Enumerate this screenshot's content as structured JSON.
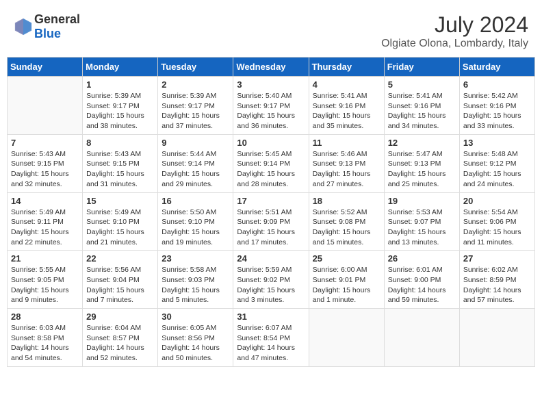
{
  "header": {
    "logo_general": "General",
    "logo_blue": "Blue",
    "month_year": "July 2024",
    "location": "Olgiate Olona, Lombardy, Italy"
  },
  "days_of_week": [
    "Sunday",
    "Monday",
    "Tuesday",
    "Wednesday",
    "Thursday",
    "Friday",
    "Saturday"
  ],
  "weeks": [
    [
      {
        "day": "",
        "sunrise": "",
        "sunset": "",
        "daylight": ""
      },
      {
        "day": "1",
        "sunrise": "Sunrise: 5:39 AM",
        "sunset": "Sunset: 9:17 PM",
        "daylight": "Daylight: 15 hours and 38 minutes."
      },
      {
        "day": "2",
        "sunrise": "Sunrise: 5:39 AM",
        "sunset": "Sunset: 9:17 PM",
        "daylight": "Daylight: 15 hours and 37 minutes."
      },
      {
        "day": "3",
        "sunrise": "Sunrise: 5:40 AM",
        "sunset": "Sunset: 9:17 PM",
        "daylight": "Daylight: 15 hours and 36 minutes."
      },
      {
        "day": "4",
        "sunrise": "Sunrise: 5:41 AM",
        "sunset": "Sunset: 9:16 PM",
        "daylight": "Daylight: 15 hours and 35 minutes."
      },
      {
        "day": "5",
        "sunrise": "Sunrise: 5:41 AM",
        "sunset": "Sunset: 9:16 PM",
        "daylight": "Daylight: 15 hours and 34 minutes."
      },
      {
        "day": "6",
        "sunrise": "Sunrise: 5:42 AM",
        "sunset": "Sunset: 9:16 PM",
        "daylight": "Daylight: 15 hours and 33 minutes."
      }
    ],
    [
      {
        "day": "7",
        "sunrise": "Sunrise: 5:43 AM",
        "sunset": "Sunset: 9:15 PM",
        "daylight": "Daylight: 15 hours and 32 minutes."
      },
      {
        "day": "8",
        "sunrise": "Sunrise: 5:43 AM",
        "sunset": "Sunset: 9:15 PM",
        "daylight": "Daylight: 15 hours and 31 minutes."
      },
      {
        "day": "9",
        "sunrise": "Sunrise: 5:44 AM",
        "sunset": "Sunset: 9:14 PM",
        "daylight": "Daylight: 15 hours and 29 minutes."
      },
      {
        "day": "10",
        "sunrise": "Sunrise: 5:45 AM",
        "sunset": "Sunset: 9:14 PM",
        "daylight": "Daylight: 15 hours and 28 minutes."
      },
      {
        "day": "11",
        "sunrise": "Sunrise: 5:46 AM",
        "sunset": "Sunset: 9:13 PM",
        "daylight": "Daylight: 15 hours and 27 minutes."
      },
      {
        "day": "12",
        "sunrise": "Sunrise: 5:47 AM",
        "sunset": "Sunset: 9:13 PM",
        "daylight": "Daylight: 15 hours and 25 minutes."
      },
      {
        "day": "13",
        "sunrise": "Sunrise: 5:48 AM",
        "sunset": "Sunset: 9:12 PM",
        "daylight": "Daylight: 15 hours and 24 minutes."
      }
    ],
    [
      {
        "day": "14",
        "sunrise": "Sunrise: 5:49 AM",
        "sunset": "Sunset: 9:11 PM",
        "daylight": "Daylight: 15 hours and 22 minutes."
      },
      {
        "day": "15",
        "sunrise": "Sunrise: 5:49 AM",
        "sunset": "Sunset: 9:10 PM",
        "daylight": "Daylight: 15 hours and 21 minutes."
      },
      {
        "day": "16",
        "sunrise": "Sunrise: 5:50 AM",
        "sunset": "Sunset: 9:10 PM",
        "daylight": "Daylight: 15 hours and 19 minutes."
      },
      {
        "day": "17",
        "sunrise": "Sunrise: 5:51 AM",
        "sunset": "Sunset: 9:09 PM",
        "daylight": "Daylight: 15 hours and 17 minutes."
      },
      {
        "day": "18",
        "sunrise": "Sunrise: 5:52 AM",
        "sunset": "Sunset: 9:08 PM",
        "daylight": "Daylight: 15 hours and 15 minutes."
      },
      {
        "day": "19",
        "sunrise": "Sunrise: 5:53 AM",
        "sunset": "Sunset: 9:07 PM",
        "daylight": "Daylight: 15 hours and 13 minutes."
      },
      {
        "day": "20",
        "sunrise": "Sunrise: 5:54 AM",
        "sunset": "Sunset: 9:06 PM",
        "daylight": "Daylight: 15 hours and 11 minutes."
      }
    ],
    [
      {
        "day": "21",
        "sunrise": "Sunrise: 5:55 AM",
        "sunset": "Sunset: 9:05 PM",
        "daylight": "Daylight: 15 hours and 9 minutes."
      },
      {
        "day": "22",
        "sunrise": "Sunrise: 5:56 AM",
        "sunset": "Sunset: 9:04 PM",
        "daylight": "Daylight: 15 hours and 7 minutes."
      },
      {
        "day": "23",
        "sunrise": "Sunrise: 5:58 AM",
        "sunset": "Sunset: 9:03 PM",
        "daylight": "Daylight: 15 hours and 5 minutes."
      },
      {
        "day": "24",
        "sunrise": "Sunrise: 5:59 AM",
        "sunset": "Sunset: 9:02 PM",
        "daylight": "Daylight: 15 hours and 3 minutes."
      },
      {
        "day": "25",
        "sunrise": "Sunrise: 6:00 AM",
        "sunset": "Sunset: 9:01 PM",
        "daylight": "Daylight: 15 hours and 1 minute."
      },
      {
        "day": "26",
        "sunrise": "Sunrise: 6:01 AM",
        "sunset": "Sunset: 9:00 PM",
        "daylight": "Daylight: 14 hours and 59 minutes."
      },
      {
        "day": "27",
        "sunrise": "Sunrise: 6:02 AM",
        "sunset": "Sunset: 8:59 PM",
        "daylight": "Daylight: 14 hours and 57 minutes."
      }
    ],
    [
      {
        "day": "28",
        "sunrise": "Sunrise: 6:03 AM",
        "sunset": "Sunset: 8:58 PM",
        "daylight": "Daylight: 14 hours and 54 minutes."
      },
      {
        "day": "29",
        "sunrise": "Sunrise: 6:04 AM",
        "sunset": "Sunset: 8:57 PM",
        "daylight": "Daylight: 14 hours and 52 minutes."
      },
      {
        "day": "30",
        "sunrise": "Sunrise: 6:05 AM",
        "sunset": "Sunset: 8:56 PM",
        "daylight": "Daylight: 14 hours and 50 minutes."
      },
      {
        "day": "31",
        "sunrise": "Sunrise: 6:07 AM",
        "sunset": "Sunset: 8:54 PM",
        "daylight": "Daylight: 14 hours and 47 minutes."
      },
      {
        "day": "",
        "sunrise": "",
        "sunset": "",
        "daylight": ""
      },
      {
        "day": "",
        "sunrise": "",
        "sunset": "",
        "daylight": ""
      },
      {
        "day": "",
        "sunrise": "",
        "sunset": "",
        "daylight": ""
      }
    ]
  ]
}
